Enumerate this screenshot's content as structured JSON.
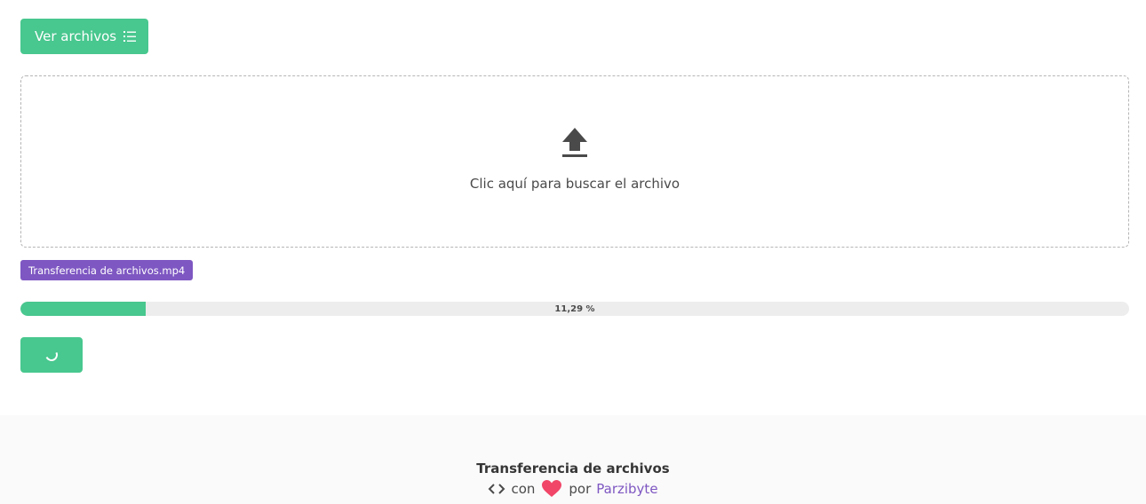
{
  "toolbar": {
    "view_files_label": "Ver archivos",
    "view_files_icon": "list-icon"
  },
  "dropzone": {
    "icon": "upload-icon",
    "text": "Clic aquí para buscar el archivo"
  },
  "upload": {
    "file_name": "Transferencia de archivos.mp4",
    "progress_fraction": 0.1129,
    "progress_text": "11,29 %",
    "button_icon": "spinner-icon"
  },
  "footer": {
    "title": "Transferencia de archivos",
    "con": "con",
    "por": "por",
    "author": "Parzibyte",
    "code_icon": "code-icon",
    "heart_icon": "heart-icon"
  },
  "colors": {
    "primary": "#48c78e",
    "tag": "#7e57c2",
    "heart": "#f14668",
    "link": "#7e57c2",
    "footer_bg": "#fafafa"
  }
}
